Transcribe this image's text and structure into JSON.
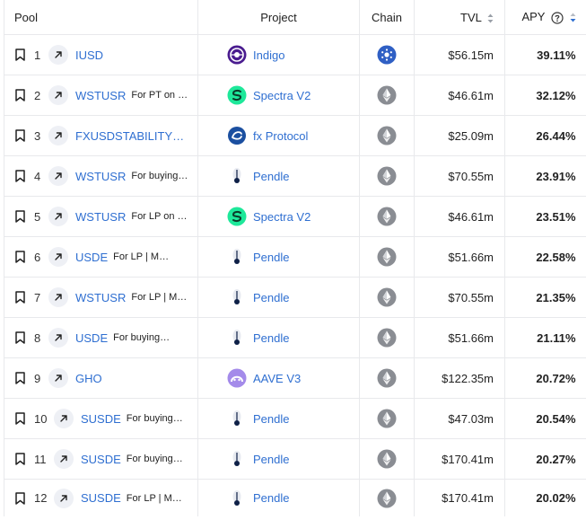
{
  "headers": {
    "pool": "Pool",
    "project": "Project",
    "chain": "Chain",
    "tvl": "TVL",
    "apy": "APY"
  },
  "colors": {
    "link": "#2f6fd1",
    "border": "#e8e9ec",
    "sort_active": "#2f6fd1"
  },
  "rows": [
    {
      "rank": "1",
      "pool": "IUSD",
      "meta": "",
      "project": "Indigo",
      "project_icon": "indigo-logo-icon",
      "chain_icon": "cardano-logo-icon",
      "tvl": "$56.15m",
      "apy": "39.11%"
    },
    {
      "rank": "2",
      "pool": "WSTUSR",
      "meta": "For PT on Spectra",
      "project": "Spectra V2",
      "project_icon": "spectra-logo-icon",
      "chain_icon": "ethereum-logo-icon",
      "tvl": "$46.61m",
      "apy": "32.12%"
    },
    {
      "rank": "3",
      "pool": "FXUSDSTABILITYPOOL",
      "meta": "",
      "project": "fx Protocol",
      "project_icon": "fx-protocol-logo-icon",
      "chain_icon": "ethereum-logo-icon",
      "tvl": "$25.09m",
      "apy": "26.44%"
    },
    {
      "rank": "4",
      "pool": "WSTUSR",
      "meta": "For buying PT-wstUSR",
      "project": "Pendle",
      "project_icon": "pendle-logo-icon",
      "chain_icon": "ethereum-logo-icon",
      "tvl": "$70.55m",
      "apy": "23.91%"
    },
    {
      "rank": "5",
      "pool": "WSTUSR",
      "meta": "For LP on Spectra",
      "project": "Spectra V2",
      "project_icon": "spectra-logo-icon",
      "chain_icon": "ethereum-logo-icon",
      "tvl": "$46.61m",
      "apy": "23.51%"
    },
    {
      "rank": "6",
      "pool": "USDE",
      "meta": "For LP | Maturity",
      "project": "Pendle",
      "project_icon": "pendle-logo-icon",
      "chain_icon": "ethereum-logo-icon",
      "tvl": "$51.66m",
      "apy": "22.58%"
    },
    {
      "rank": "7",
      "pool": "WSTUSR",
      "meta": "For LP | Maturity",
      "project": "Pendle",
      "project_icon": "pendle-logo-icon",
      "chain_icon": "ethereum-logo-icon",
      "tvl": "$70.55m",
      "apy": "21.35%"
    },
    {
      "rank": "8",
      "pool": "USDE",
      "meta": "For buying PT-USDe",
      "project": "Pendle",
      "project_icon": "pendle-logo-icon",
      "chain_icon": "ethereum-logo-icon",
      "tvl": "$51.66m",
      "apy": "21.11%"
    },
    {
      "rank": "9",
      "pool": "GHO",
      "meta": "",
      "project": "AAVE V3",
      "project_icon": "aave-logo-icon",
      "chain_icon": "ethereum-logo-icon",
      "tvl": "$122.35m",
      "apy": "20.72%"
    },
    {
      "rank": "10",
      "pool": "SUSDE",
      "meta": "For buying PT-sUSDe",
      "project": "Pendle",
      "project_icon": "pendle-logo-icon",
      "chain_icon": "ethereum-logo-icon",
      "tvl": "$47.03m",
      "apy": "20.54%"
    },
    {
      "rank": "11",
      "pool": "SUSDE",
      "meta": "For buying PT-sUSDe",
      "project": "Pendle",
      "project_icon": "pendle-logo-icon",
      "chain_icon": "ethereum-logo-icon",
      "tvl": "$170.41m",
      "apy": "20.27%"
    },
    {
      "rank": "12",
      "pool": "SUSDE",
      "meta": "For LP | Maturity",
      "project": "Pendle",
      "project_icon": "pendle-logo-icon",
      "chain_icon": "ethereum-logo-icon",
      "tvl": "$170.41m",
      "apy": "20.02%"
    }
  ]
}
